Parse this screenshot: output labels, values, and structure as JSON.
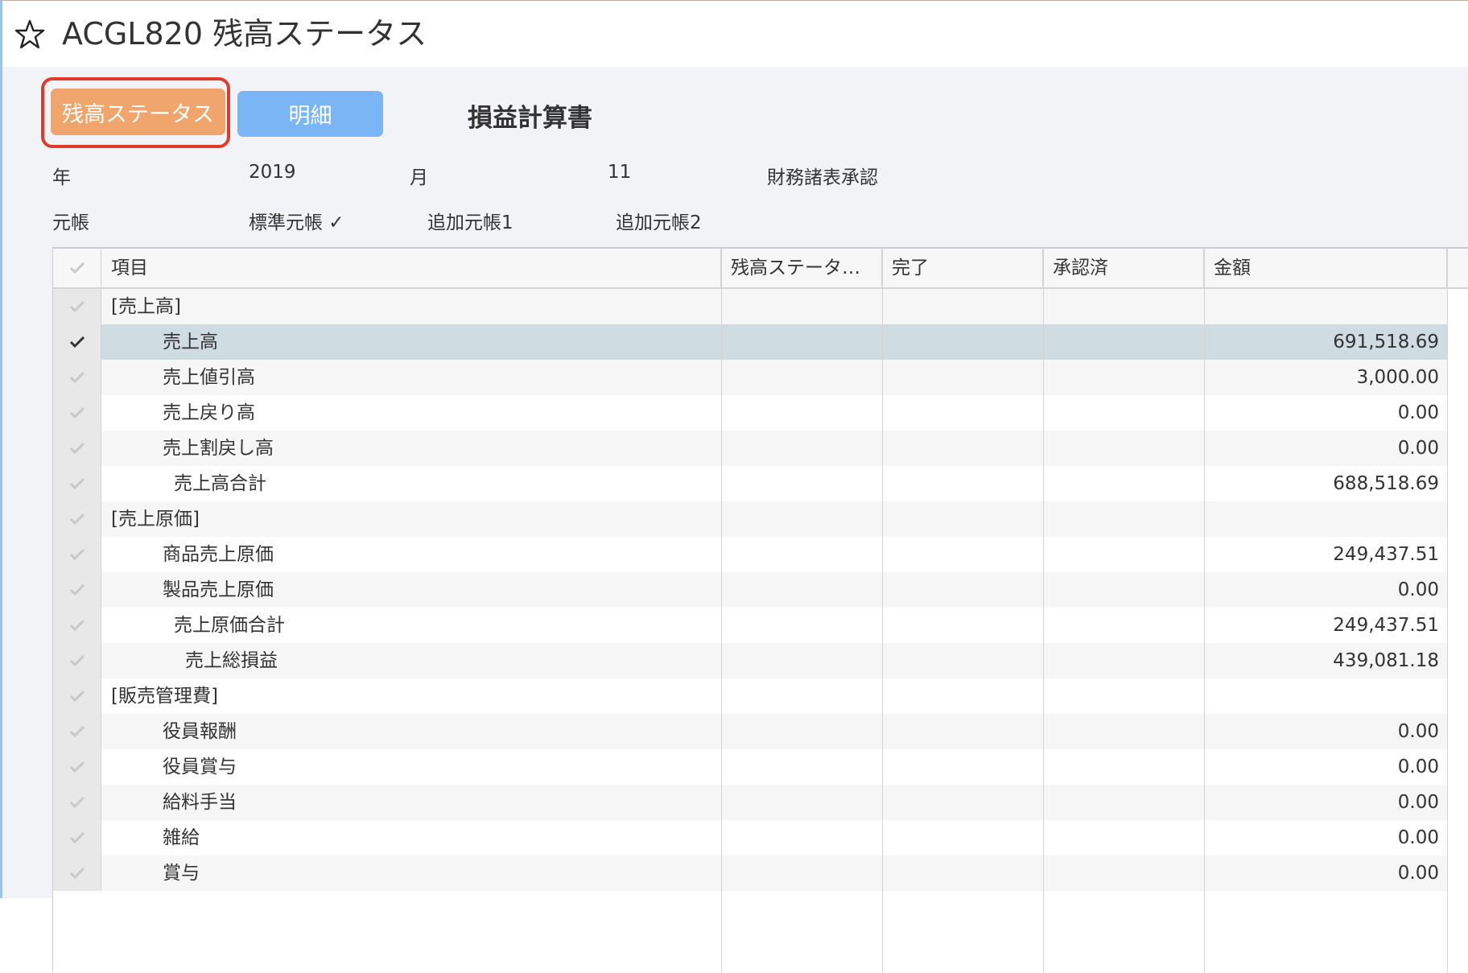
{
  "window": {
    "title": "ACGL820 残高ステータス"
  },
  "toolbar": {
    "status_button": "残高ステータス",
    "detail_button": "明細",
    "report_title": "損益計算書"
  },
  "filters": {
    "year_label": "年",
    "year_value": "2019",
    "month_label": "月",
    "month_value": "11",
    "approval_label": "財務諸表承認",
    "ledger_label": "元帳",
    "ledger_standard": "標準元帳 ✓",
    "ledger_extra1": "追加元帳1",
    "ledger_extra2": "追加元帳2"
  },
  "table": {
    "columns": [
      "項目",
      "残高ステータ…",
      "完了",
      "承認済",
      "金額"
    ],
    "rows": [
      {
        "label": "[売上高]",
        "indent": 0,
        "amount": "",
        "selected": false
      },
      {
        "label": "売上高",
        "indent": 2,
        "amount": "691,518.69",
        "selected": true
      },
      {
        "label": "売上値引高",
        "indent": 2,
        "amount": "3,000.00",
        "selected": false
      },
      {
        "label": "売上戻り高",
        "indent": 2,
        "amount": "0.00",
        "selected": false
      },
      {
        "label": "売上割戻し高",
        "indent": 2,
        "amount": "0.00",
        "selected": false
      },
      {
        "label": "売上高合計",
        "indent": 3,
        "amount": "688,518.69",
        "selected": false
      },
      {
        "label": "[売上原価]",
        "indent": 0,
        "amount": "",
        "selected": false
      },
      {
        "label": "商品売上原価",
        "indent": 2,
        "amount": "249,437.51",
        "selected": false
      },
      {
        "label": "製品売上原価",
        "indent": 2,
        "amount": "0.00",
        "selected": false
      },
      {
        "label": "売上原価合計",
        "indent": 3,
        "amount": "249,437.51",
        "selected": false
      },
      {
        "label": "売上総損益",
        "indent": 4,
        "amount": "439,081.18",
        "selected": false
      },
      {
        "label": "[販売管理費]",
        "indent": 0,
        "amount": "",
        "selected": false
      },
      {
        "label": "役員報酬",
        "indent": 2,
        "amount": "0.00",
        "selected": false
      },
      {
        "label": "役員賞与",
        "indent": 2,
        "amount": "0.00",
        "selected": false
      },
      {
        "label": "給料手当",
        "indent": 2,
        "amount": "0.00",
        "selected": false
      },
      {
        "label": "雑給",
        "indent": 2,
        "amount": "0.00",
        "selected": false
      },
      {
        "label": "賞与",
        "indent": 2,
        "amount": "0.00",
        "selected": false
      }
    ]
  },
  "colors": {
    "status_button": "#f0a56d",
    "detail_button": "#7ab6f5",
    "focus_ring": "#e03a2a",
    "selected_row": "#cfdde3"
  },
  "icons": {
    "favorite": "star-outline-icon",
    "row_check": "checkmark-icon"
  }
}
